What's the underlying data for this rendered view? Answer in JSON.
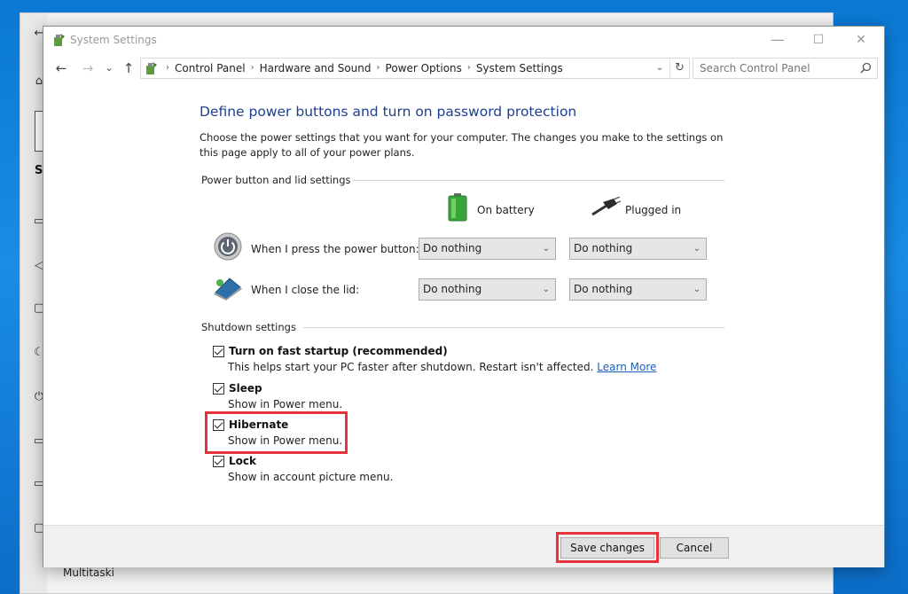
{
  "window": {
    "title": "System Settings",
    "controls": {
      "minimize": "—",
      "maximize": "☐",
      "close": "✕"
    }
  },
  "address": {
    "back": "←",
    "forward": "→",
    "recent": "⌄",
    "up": "↑",
    "crumbs": [
      "Control Panel",
      "Hardware and Sound",
      "Power Options",
      "System Settings"
    ],
    "separator": "›",
    "dropdown": "⌄",
    "refresh": "↻"
  },
  "search": {
    "placeholder": "Search Control Panel"
  },
  "page": {
    "title": "Define power buttons and turn on password protection",
    "intro": "Choose the power settings that you want for your computer. The changes you make to the settings on this page apply to all of your power plans."
  },
  "power_section": {
    "heading": "Power button and lid settings",
    "columns": {
      "battery": "On battery",
      "plugged": "Plugged in"
    },
    "rows": [
      {
        "label": "When I press the power button:",
        "battery": "Do nothing",
        "plugged": "Do nothing"
      },
      {
        "label": "When I close the lid:",
        "battery": "Do nothing",
        "plugged": "Do nothing"
      }
    ]
  },
  "shutdown_section": {
    "heading": "Shutdown settings",
    "items": [
      {
        "label": "Turn on fast startup (recommended)",
        "desc": "This helps start your PC faster after shutdown. Restart isn't affected.",
        "link": "Learn More",
        "checked": true
      },
      {
        "label": "Sleep",
        "desc": "Show in Power menu.",
        "checked": true
      },
      {
        "label": "Hibernate",
        "desc": "Show in Power menu.",
        "checked": true
      },
      {
        "label": "Lock",
        "desc": "Show in account picture menu.",
        "checked": true
      }
    ]
  },
  "footer": {
    "save": "Save changes",
    "cancel": "Cancel"
  },
  "background_window": {
    "partial_heading": "Sy",
    "partial_bottom_text": "Multitaski"
  },
  "colors": {
    "title_blue": "#1e3f8f",
    "highlight_red": "#e8323c",
    "link_blue": "#1a5fb4",
    "desktop_blue": "#0a78d4"
  }
}
